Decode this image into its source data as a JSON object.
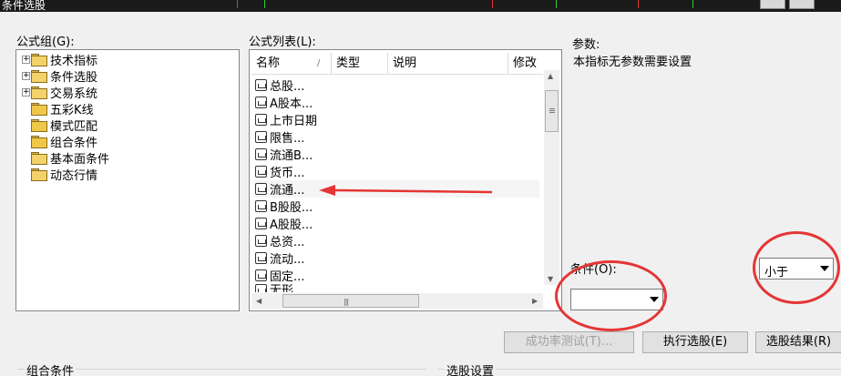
{
  "window": {
    "title": "条件选股"
  },
  "formula_group": {
    "label": "公式组(G):",
    "items": [
      {
        "label": "技术指标",
        "expandable": true
      },
      {
        "label": "条件选股",
        "expandable": true
      },
      {
        "label": "交易系统",
        "expandable": true
      },
      {
        "label": "五彩K线",
        "expandable": false
      },
      {
        "label": "模式匹配",
        "expandable": false
      },
      {
        "label": "组合条件",
        "expandable": false
      },
      {
        "label": "基本面条件",
        "expandable": false
      },
      {
        "label": "动态行情",
        "expandable": false
      }
    ]
  },
  "formula_list": {
    "label": "公式列表(L):",
    "columns": [
      "名称",
      "类型",
      "说明",
      "修改"
    ],
    "sort_indicator": "/",
    "rows": [
      "总股...",
      "A股本...",
      "上市日期",
      "限售...",
      "流通B...",
      "货币...",
      "流通...",
      "B股股...",
      "A股股...",
      "总资...",
      "流动...",
      "固定..."
    ],
    "partial_row": "无形...",
    "selected_row": "流通..."
  },
  "params": {
    "label": "参数:",
    "text": "本指标无参数需要设置"
  },
  "condition": {
    "label": "条件(O):",
    "operator_value": "小于",
    "value": ""
  },
  "buttons": {
    "success_test": "成功率测试(T)...",
    "execute": "执行选股(E)",
    "result": "选股结果(R)"
  },
  "bottom": {
    "combined_conditions": "组合条件",
    "stock_settings": "选股设置"
  },
  "colors": {
    "annotation_red": "#e53535",
    "title_bar": "#1a1a1a"
  }
}
